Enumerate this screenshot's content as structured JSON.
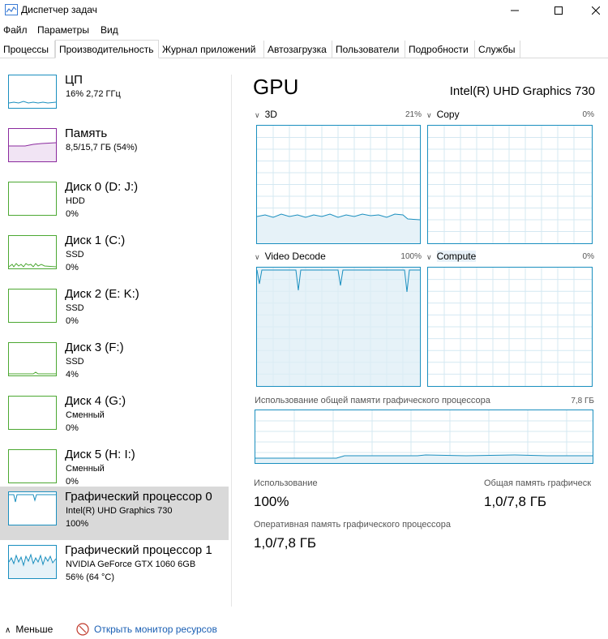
{
  "window": {
    "title": "Диспетчер задач"
  },
  "menu": [
    "Файл",
    "Параметры",
    "Вид"
  ],
  "tabs": [
    {
      "label": "Процессы",
      "active": false
    },
    {
      "label": "Производительность",
      "active": true
    },
    {
      "label": "Журнал приложений",
      "active": false
    },
    {
      "label": "Автозагрузка",
      "active": false
    },
    {
      "label": "Пользователи",
      "active": false
    },
    {
      "label": "Подробности",
      "active": false
    },
    {
      "label": "Службы",
      "active": false
    }
  ],
  "sidebar": [
    {
      "name": "ЦП",
      "line2": "16% 2,72 ГГц",
      "line3": "",
      "color": "#1a8fbf"
    },
    {
      "name": "Память",
      "line2": "8,5/15,7 ГБ (54%)",
      "line3": "",
      "color": "#8b2a9e"
    },
    {
      "name": "Диск 0 (D: J:)",
      "line2": "HDD",
      "line3": "0%",
      "color": "#4ca832"
    },
    {
      "name": "Диск 1 (C:)",
      "line2": "SSD",
      "line3": "0%",
      "color": "#4ca832"
    },
    {
      "name": "Диск 2 (E: K:)",
      "line2": "SSD",
      "line3": "0%",
      "color": "#4ca832"
    },
    {
      "name": "Диск 3 (F:)",
      "line2": "SSD",
      "line3": "4%",
      "color": "#4ca832"
    },
    {
      "name": "Диск 4 (G:)",
      "line2": "Сменный",
      "line3": "0%",
      "color": "#4ca832"
    },
    {
      "name": "Диск 5 (H: I:)",
      "line2": "Сменный",
      "line3": "0%",
      "color": "#4ca832"
    },
    {
      "name": "Графический процессор 0",
      "line2": "Intel(R) UHD Graphics 730",
      "line3": "100%",
      "color": "#1a8fbf",
      "selected": true
    },
    {
      "name": "Графический процессор 1",
      "line2": "NVIDIA GeForce GTX 1060 6GB",
      "line3": "56% (64 °C)",
      "color": "#1a8fbf"
    }
  ],
  "main": {
    "title": "GPU",
    "model": "Intel(R) UHD Graphics 730",
    "graphs": [
      {
        "label": "3D",
        "pct": "21%"
      },
      {
        "label": "Copy",
        "pct": "0%"
      },
      {
        "label": "Video Decode",
        "pct": "100%"
      },
      {
        "label": "Compute",
        "pct": "0%"
      }
    ],
    "shared_memory": {
      "label": "Использование общей памяти графического процессора",
      "max": "7,8 ГБ"
    },
    "stats": {
      "usage_label": "Использование",
      "usage_value": "100%",
      "shared_label": "Общая память графическ",
      "shared_value": "1,0/7,8 ГБ",
      "ram_label": "Оперативная память графического процессора",
      "ram_value": "1,0/7,8 ГБ"
    }
  },
  "footer": {
    "fewer": "Меньше",
    "monitor_link": "Открыть монитор ресурсов"
  },
  "icons": {
    "fewer": "chevron-up-icon",
    "monitor": "resource-monitor-icon",
    "app": "task-manager-icon"
  }
}
